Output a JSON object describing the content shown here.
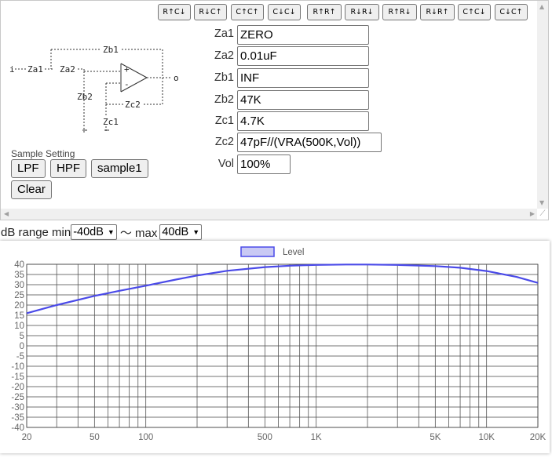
{
  "toolbar": {
    "buttons": [
      "R↑C↓",
      "R↓C↑",
      "C↑C↑",
      "C↓C↓",
      "R↑R↑",
      "R↓R↓",
      "R↑R↓",
      "R↓R↑",
      "C↑C↓",
      "C↓C↑"
    ]
  },
  "circuit": {
    "labels": {
      "input": "i",
      "za1": "Za1",
      "za2": "Za2",
      "zb1": "Zb1",
      "zb2": "Zb2",
      "zc1": "Zc1",
      "zc2": "Zc2",
      "plus": "+",
      "minus": "-",
      "output": "o"
    }
  },
  "params": {
    "za1": {
      "label": "Za1",
      "value": "ZERO"
    },
    "za2": {
      "label": "Za2",
      "value": "0.01uF"
    },
    "zb1": {
      "label": "Zb1",
      "value": "INF"
    },
    "zb2": {
      "label": "Zb2",
      "value": "47K"
    },
    "zc1": {
      "label": "Zc1",
      "value": "4.7K"
    },
    "zc2": {
      "label": "Zc2",
      "value": "47pF//(VRA(500K,Vol))"
    },
    "vol": {
      "label": "Vol",
      "value": "100%"
    }
  },
  "samples": {
    "heading": "Sample Setting",
    "lpf": "LPF",
    "hpf": "HPF",
    "sample1": "sample1",
    "clear": "Clear"
  },
  "range": {
    "prefix": "dB range min",
    "min_value": "-40dB",
    "separator": "〜 max",
    "max_value": "40dB"
  },
  "chart_data": {
    "type": "line",
    "title": "",
    "xlabel": "",
    "ylabel": "",
    "x_scale": "log",
    "xlim": [
      20,
      20000
    ],
    "ylim": [
      -40,
      40
    ],
    "x_ticks": [
      20,
      50,
      100,
      500,
      1000,
      5000,
      10000,
      20000
    ],
    "x_tick_labels": [
      "20",
      "50",
      "100",
      "500",
      "1K",
      "5K",
      "10K",
      "20K"
    ],
    "y_ticks": [
      40,
      35,
      30,
      25,
      20,
      15,
      10,
      5,
      0,
      -5,
      -10,
      -15,
      -20,
      -25,
      -30,
      -35,
      -40
    ],
    "grid": true,
    "legend": "top-center",
    "series": [
      {
        "name": "Level",
        "color": "#4a4ae8",
        "x": [
          20,
          30,
          50,
          70,
          100,
          150,
          200,
          300,
          500,
          700,
          1000,
          1500,
          2000,
          3000,
          5000,
          7000,
          10000,
          15000,
          20000
        ],
        "y": [
          16,
          20,
          24.5,
          27,
          29.5,
          32.5,
          34.5,
          36.8,
          38.6,
          39.3,
          39.7,
          39.9,
          39.9,
          39.7,
          39.1,
          38.3,
          36.7,
          33.8,
          30.9
        ]
      }
    ]
  }
}
